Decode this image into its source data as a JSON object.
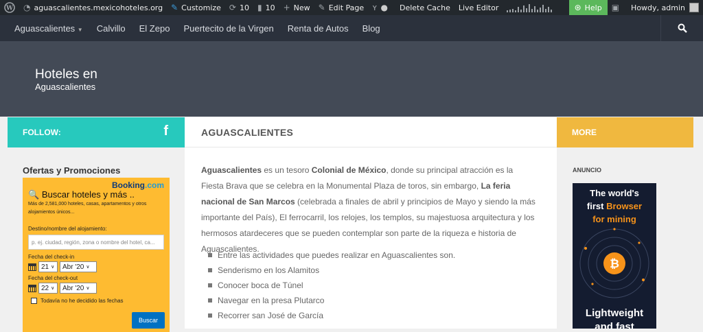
{
  "admin_bar": {
    "site": "aguascalientes.mexicohoteles.org",
    "customize": "Customize",
    "updates_count": "10",
    "comments_count": "10",
    "new": "New",
    "edit_page": "Edit Page",
    "delete_cache": "Delete Cache",
    "live_editor": "Live Editor",
    "help": "Help",
    "howdy": "Howdy, admin"
  },
  "nav": {
    "items": [
      "Aguascalientes",
      "Calvillo",
      "El Zepo",
      "Puertecito de la Virgen",
      "Renta de Autos",
      "Blog"
    ]
  },
  "hero": {
    "title": "Hoteles en",
    "subtitle": "Aguascalientes"
  },
  "follow": {
    "label": "FOLLOW:"
  },
  "promo": {
    "title": "Ofertas y Promociones",
    "logo_booking": "Booking",
    "logo_com": ".com",
    "heading": "Buscar hoteles y más ..",
    "desc": "Más de 2,581,000 hoteles, casas, apartamentos y otros alojamientos únicos...",
    "dest_label": "Destino/nombre del alojamiento:",
    "dest_placeholder": "p. ej. ciudad, región, zona o nombre del hotel, ca...",
    "checkin_label": "Fecha del check-in",
    "checkin_day": "21",
    "checkin_month": "Abr '20",
    "checkout_label": "Fecha del check-out",
    "checkout_day": "22",
    "checkout_month": "Abr '20",
    "no_dates": "Todavía no he decidido las fechas",
    "search_button": "Buscar"
  },
  "main": {
    "heading": "AGUASCALIENTES",
    "intro": {
      "b1": "Aguascalientes",
      "t1": " es un tesoro ",
      "b2": "Colonial de México",
      "t2": ", donde su principal atracción es la Fiesta Brava que se celebra en la Monumental Plaza de toros, sin embargo, ",
      "b3": "La feria nacional de San Marcos",
      "t3": " (celebrada a finales de abril y principios de Mayo y siendo la más importante del País), El ferrocarril, los relojes, los templos, su majestuosa arquitectura y los hermosos atardeceres que se pueden contemplar son parte de la riqueza e historia de Aguascalientes."
    },
    "activities": [
      "Entre las actividades que puedes realizar en Aguascalientes son.",
      "Senderismo en los Alamitos",
      "Conocer boca de Túnel",
      "Navegar en la presa Plutarco",
      "Recorrer san José de García"
    ]
  },
  "more": {
    "label": "MORE"
  },
  "sidebar_right": {
    "anuncio": "ANUNCIO",
    "ad_line1": "The world's",
    "ad_first": "first ",
    "ad_browser": "Browser",
    "ad_line3": "for mining",
    "ad_line4": "Lightweight",
    "ad_line5": "and fast"
  }
}
